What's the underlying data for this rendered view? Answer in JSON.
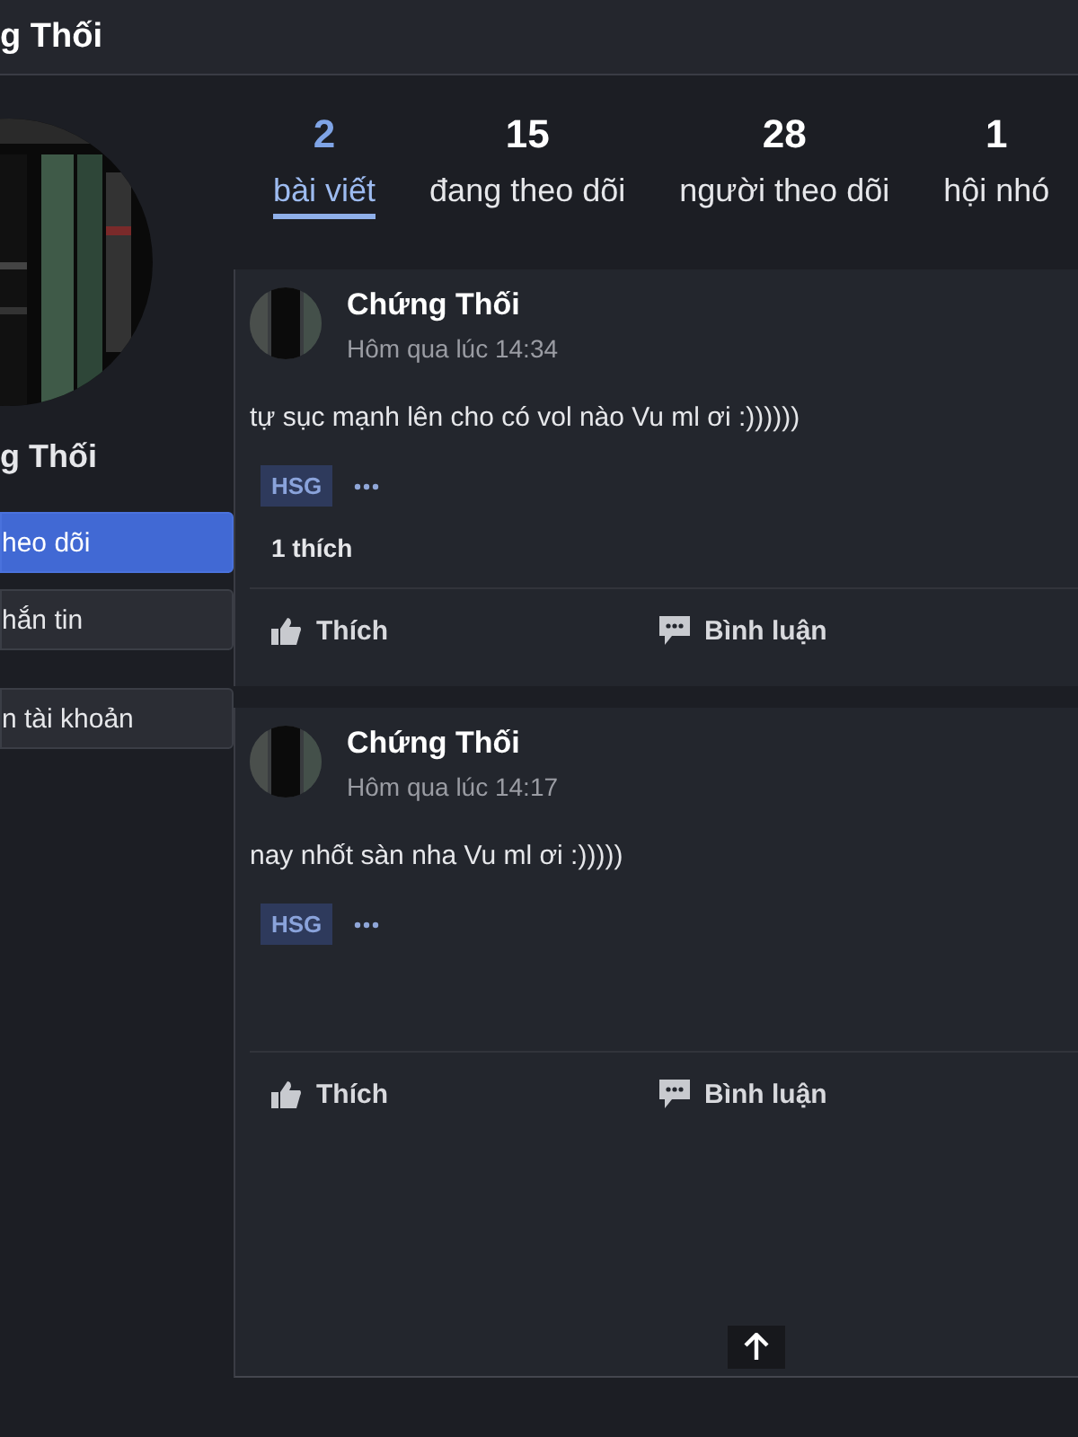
{
  "header": {
    "title": "g Thối"
  },
  "profile": {
    "name": "g Thối",
    "buttons": [
      {
        "label": "heo dõi",
        "primary": true
      },
      {
        "label": "hắn tin",
        "primary": false
      },
      {
        "label": "n tài khoản",
        "primary": false
      }
    ]
  },
  "stats": [
    {
      "count": "2",
      "label": "bài viết",
      "selected": true
    },
    {
      "count": "15",
      "label": "đang theo dõi",
      "selected": false
    },
    {
      "count": "28",
      "label": "người theo dõi",
      "selected": false
    },
    {
      "count": "1",
      "label": "hội nhó",
      "selected": false
    }
  ],
  "posts": [
    {
      "author": "Chứng Thối",
      "time": "Hôm qua lúc 14:34",
      "text": "tự sục mạnh lên cho có vol nào Vu ml ơi :))))))",
      "tags": [
        "HSG"
      ],
      "likes": "1 thích",
      "actions": [
        "Thích",
        "Bình luận"
      ]
    },
    {
      "author": "Chứng Thối",
      "time": "Hôm qua lúc 14:17",
      "text": "nay nhốt sàn nha Vu ml ơi :)))))",
      "tags": [
        "HSG"
      ],
      "actions": [
        "Thích",
        "Bình luận"
      ]
    }
  ]
}
